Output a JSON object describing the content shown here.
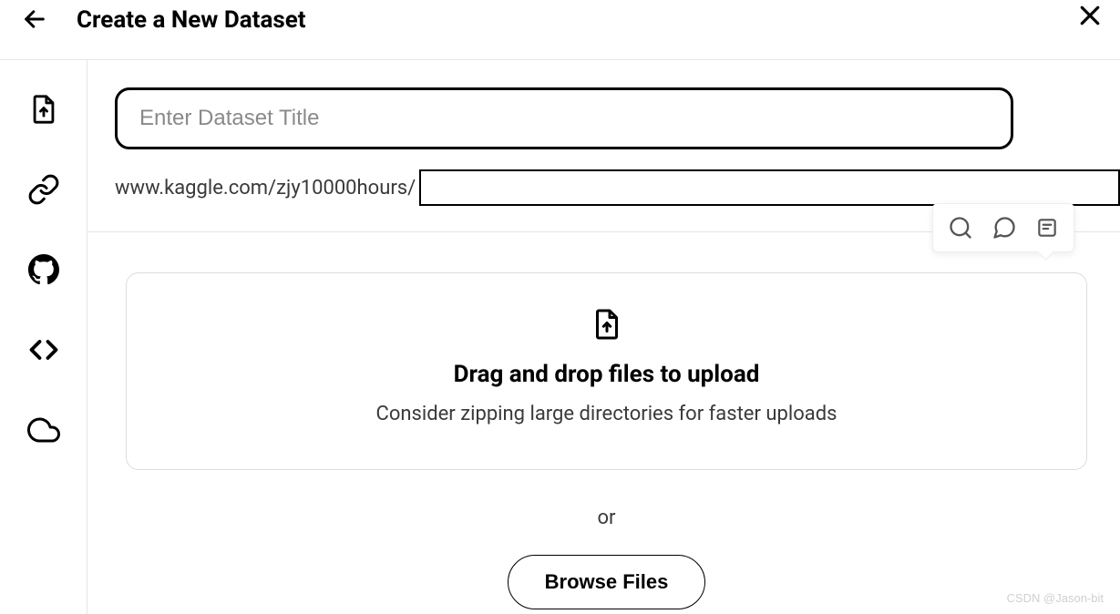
{
  "header": {
    "title": "Create a New Dataset"
  },
  "form": {
    "title_placeholder": "Enter Dataset Title",
    "title_value": "",
    "url_prefix": "www.kaggle.com/zjy10000hours/",
    "slug_value": ""
  },
  "sidebar": {
    "items": [
      {
        "name": "file-upload-icon"
      },
      {
        "name": "link-icon"
      },
      {
        "name": "github-icon"
      },
      {
        "name": "code-icon"
      },
      {
        "name": "cloud-icon"
      }
    ]
  },
  "dropzone": {
    "title": "Drag and drop files to upload",
    "subtitle": "Consider zipping large directories for faster uploads",
    "or_label": "or",
    "browse_label": "Browse Files"
  },
  "toolbar": {
    "items": [
      {
        "name": "search-icon"
      },
      {
        "name": "comment-icon"
      },
      {
        "name": "note-icon"
      }
    ]
  },
  "watermark": "CSDN @Jason-bit"
}
